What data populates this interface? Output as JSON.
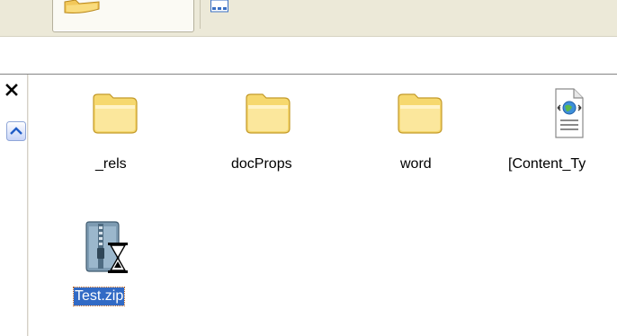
{
  "toolbar": {
    "folders_button_icon": "folder-icon",
    "views_button_icon": "views-icon"
  },
  "task_pane": {
    "close_icon": "close-icon",
    "collapse_icon": "chevron-up-icon"
  },
  "files": [
    {
      "name": "_rels",
      "icon": "folder-icon",
      "selected": false
    },
    {
      "name": "docProps",
      "icon": "folder-icon",
      "selected": false
    },
    {
      "name": "word",
      "icon": "folder-icon",
      "selected": false
    },
    {
      "name": "[Content_Ty",
      "icon": "xml-document-icon",
      "selected": false
    },
    {
      "name": "Test.zip",
      "icon": "zip-hourglass-icon",
      "selected": true
    }
  ],
  "colors": {
    "toolbar_bg": "#ece9d8",
    "selection_bg": "#316ac5",
    "folder_fill": "#f7de7a",
    "folder_stroke": "#c7a034"
  }
}
